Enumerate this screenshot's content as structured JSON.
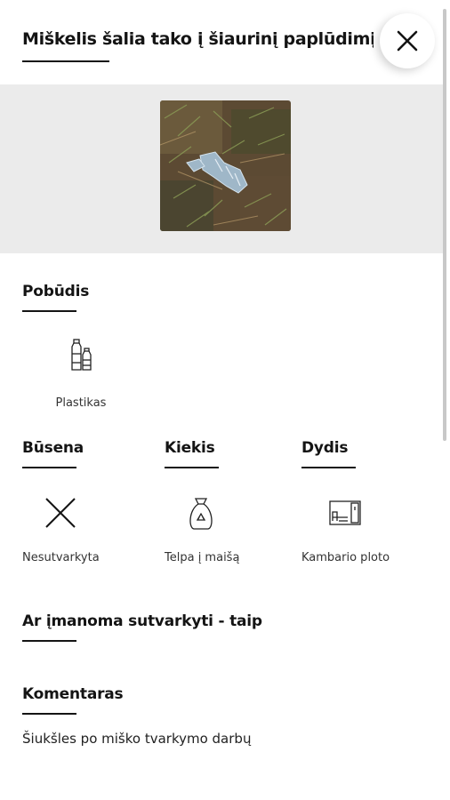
{
  "header": {
    "title": "Miškelis šalia tako į šiaurinį paplūdimį"
  },
  "close": {
    "icon": "close-icon"
  },
  "photo": {
    "alt": "Šiukšlės"
  },
  "pobudis": {
    "heading": "Pobūdis",
    "items": [
      {
        "label": "Plastikas",
        "icon": "plastic-bottles-icon"
      }
    ]
  },
  "busena": {
    "heading": "Būsena",
    "value": "Nesutvarkyta",
    "icon": "cross-icon"
  },
  "kiekis": {
    "heading": "Kiekis",
    "value": "Telpa į maišą",
    "icon": "recycle-bag-icon"
  },
  "dydis": {
    "heading": "Dydis",
    "value": "Kambario ploto",
    "icon": "room-size-icon"
  },
  "cleanable": {
    "heading": "Ar įmanoma sutvarkyti - taip"
  },
  "comment": {
    "heading": "Komentaras",
    "text": "Šiukšles po miško tvarkymo darbų"
  }
}
